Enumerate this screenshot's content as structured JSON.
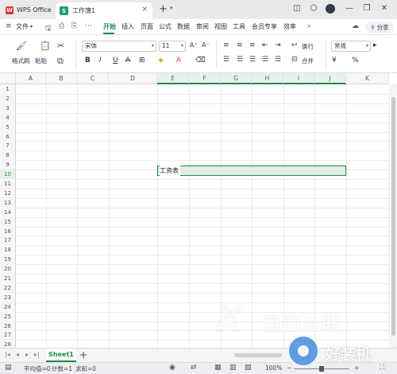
{
  "titlebar": {
    "app_name": "WPS Office",
    "app_logo": "W",
    "doc_tab_icon": "S",
    "doc_tab_title": "工作簿1",
    "close_glyph": "×",
    "new_tab_glyph": "+",
    "new_tab_arrow": "▾"
  },
  "menubar": {
    "file_label": "文件",
    "file_caret": "▾",
    "items": [
      "开始",
      "插入",
      "页面",
      "公式",
      "数据",
      "审阅",
      "视图",
      "工具",
      "会员专享",
      "效率"
    ],
    "active_index": 0,
    "share_label": "分享"
  },
  "ribbon": {
    "format_painter_label": "格式刷",
    "paste_label": "粘贴",
    "font_name": "宋体",
    "font_size": "11",
    "bold": "B",
    "italic": "I",
    "underline": "U",
    "strikethrough": "A",
    "wrap_label": "换行",
    "merge_label": "合并",
    "number_format": "常规",
    "currency_glyph": "¥",
    "percent_glyph": "%",
    "grow_font": "A⁺",
    "shrink_font": "A⁻"
  },
  "grid": {
    "columns": [
      "A",
      "B",
      "C",
      "D",
      "E",
      "F",
      "G",
      "H",
      "I",
      "J",
      "K"
    ],
    "selected_columns": [
      "E",
      "F",
      "G",
      "H",
      "I",
      "J"
    ],
    "rows": [
      "1",
      "2",
      "3",
      "4",
      "5",
      "6",
      "7",
      "8",
      "9",
      "10",
      "11",
      "12",
      "13",
      "14",
      "15",
      "16",
      "17",
      "18",
      "19",
      "20",
      "21",
      "22",
      "23",
      "24",
      "25",
      "26",
      "27",
      "28"
    ],
    "selected_row": "10",
    "cell_E10": "工资表"
  },
  "sheetbar": {
    "nav_first": "|◂",
    "nav_prev": "◂",
    "nav_next": "▸",
    "nav_last": "▸|",
    "active_sheet": "Sheet1",
    "add_glyph": "+"
  },
  "statusbar": {
    "average": "平均值=0",
    "count": "计数=1",
    "sum": "求和=0",
    "zoom": "100%",
    "zoom_minus": "−",
    "zoom_plus": "+"
  },
  "watermark": {
    "logo_glyph": "X",
    "brand": "自由互联",
    "site": "好装机"
  },
  "colors": {
    "accent": "#1f8a4c",
    "wps_red": "#e3362e",
    "sheet_green": "#1b9c5a",
    "selection_fill": "#e2ede6"
  }
}
